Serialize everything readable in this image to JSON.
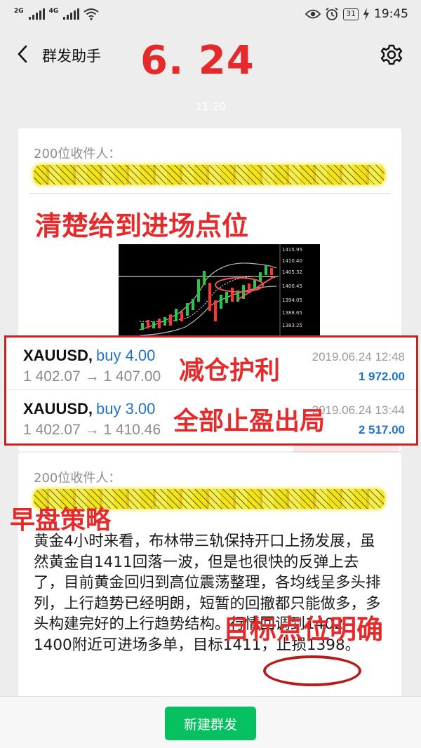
{
  "status_bar": {
    "net1": "2G",
    "net2": "4G",
    "battery": "31",
    "time": "19:45"
  },
  "header": {
    "title": "群发助手",
    "overlay_date": "6. 24"
  },
  "timestamp": "11:20",
  "card1": {
    "recipients": "200位收件人：",
    "overlay_heading": "清楚给到进场点位",
    "chart_prices": [
      "1415.95",
      "1410.40",
      "1405.32",
      "1400.45",
      "1394.05",
      "1388.65",
      "1383.25"
    ],
    "trades": [
      {
        "symbol": "XAUUSD,",
        "side": "buy 4.00",
        "prices": "1 402.07 → 1 407.00",
        "date": "2019.06.24 12:48",
        "profit": "1 972.00",
        "overlay": "减仓护利"
      },
      {
        "symbol": "XAUUSD,",
        "side": "buy 3.00",
        "prices": "1 402.07 → 1 410.46",
        "date": "2019.06.24 13:44",
        "profit": "2 517.00",
        "overlay": "全部止盈出局"
      }
    ]
  },
  "card2": {
    "recipients": "200位收件人：",
    "overlay_heading": "早盘策略",
    "body": "黄金4小时来看，布林带三轨保持开口上扬发展，虽然黄金自1411回落一波，但是也很快的反弹上去了，目前黄金回归到高位震荡整理，各均线呈多头排列，上行趋势已经明朗，短暂的回撤都只能做多，多头构建完好的上行趋势结构。行情回调到1402-1400附近可进场多单，目标1411，止损1398。",
    "overlay_note": "目标点位明确"
  },
  "bottom": {
    "new_button": "新建群发"
  },
  "colors": {
    "accent_green": "#07c160",
    "annotation_red": "#e42a2a",
    "link_blue": "#1f73c9"
  }
}
